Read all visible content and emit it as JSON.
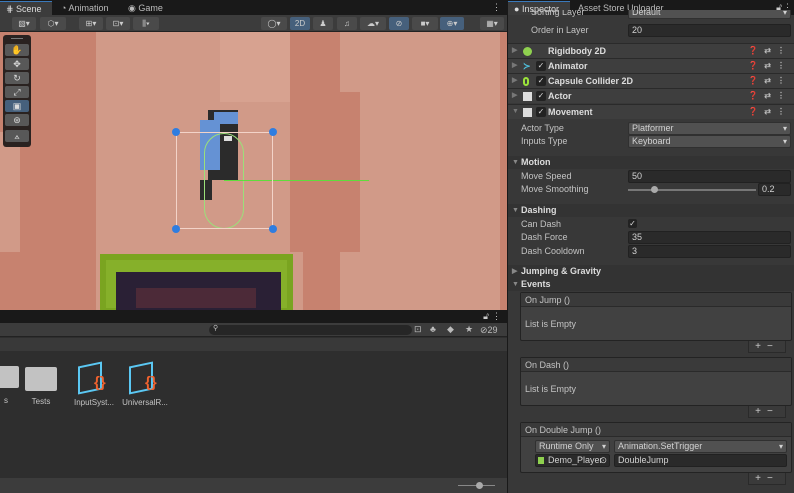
{
  "scene_panel": {
    "tabs": [
      {
        "label": "Scene",
        "icon": "grid-icon"
      },
      {
        "label": "Animation",
        "icon": "clock-icon"
      },
      {
        "label": "Game",
        "icon": "gamepad-icon"
      }
    ],
    "toolbar": {
      "mode_2d": "2D"
    }
  },
  "tools": [
    "hand",
    "move",
    "rotate",
    "scale",
    "rect",
    "transform",
    "custom"
  ],
  "project": {
    "count": "29",
    "search_placeholder": "",
    "assets": [
      {
        "name": "s",
        "type": "folder"
      },
      {
        "name": "Tests",
        "type": "folder"
      },
      {
        "name": "InputSyst...",
        "type": "package"
      },
      {
        "name": "UniversalR...",
        "type": "package"
      }
    ]
  },
  "inspector": {
    "tabs": [
      "Inspector",
      "Asset Store Uploader"
    ],
    "sorting_layer": {
      "label": "Sorting Layer",
      "value": "Default"
    },
    "order_in_layer": {
      "label": "Order in Layer",
      "value": "20"
    },
    "components": [
      {
        "name": "Rigidbody 2D",
        "color": "#8fd14f"
      },
      {
        "name": "Animator",
        "color": "#4fc3e0"
      },
      {
        "name": "Capsule Collider 2D",
        "color": "#9be33a"
      },
      {
        "name": "Actor",
        "color": "#ddd"
      },
      {
        "name": "Movement",
        "color": "#ddd"
      }
    ],
    "movement": {
      "actor_type": {
        "label": "Actor Type",
        "value": "Platformer"
      },
      "inputs_type": {
        "label": "Inputs Type",
        "value": "Keyboard"
      }
    },
    "motion": {
      "title": "Motion",
      "move_speed": {
        "label": "Move Speed",
        "value": "50"
      },
      "move_smoothing": {
        "label": "Move Smoothing",
        "value": "0.2",
        "fraction": 0.2
      }
    },
    "dashing": {
      "title": "Dashing",
      "can_dash": {
        "label": "Can Dash",
        "checked": true
      },
      "dash_force": {
        "label": "Dash Force",
        "value": "35"
      },
      "dash_cooldown": {
        "label": "Dash Cooldown",
        "value": "3"
      }
    },
    "jumping": {
      "title": "Jumping & Gravity"
    },
    "events": {
      "title": "Events",
      "on_jump": {
        "label": "On Jump ()",
        "empty": "List is Empty"
      },
      "on_dash": {
        "label": "On Dash ()",
        "empty": "List is Empty"
      },
      "on_double_jump": {
        "label": "On Double Jump ()",
        "mode": "Runtime Only",
        "function": "Animation.SetTrigger",
        "target": "Demo_Player",
        "arg": "DoubleJump"
      }
    }
  }
}
